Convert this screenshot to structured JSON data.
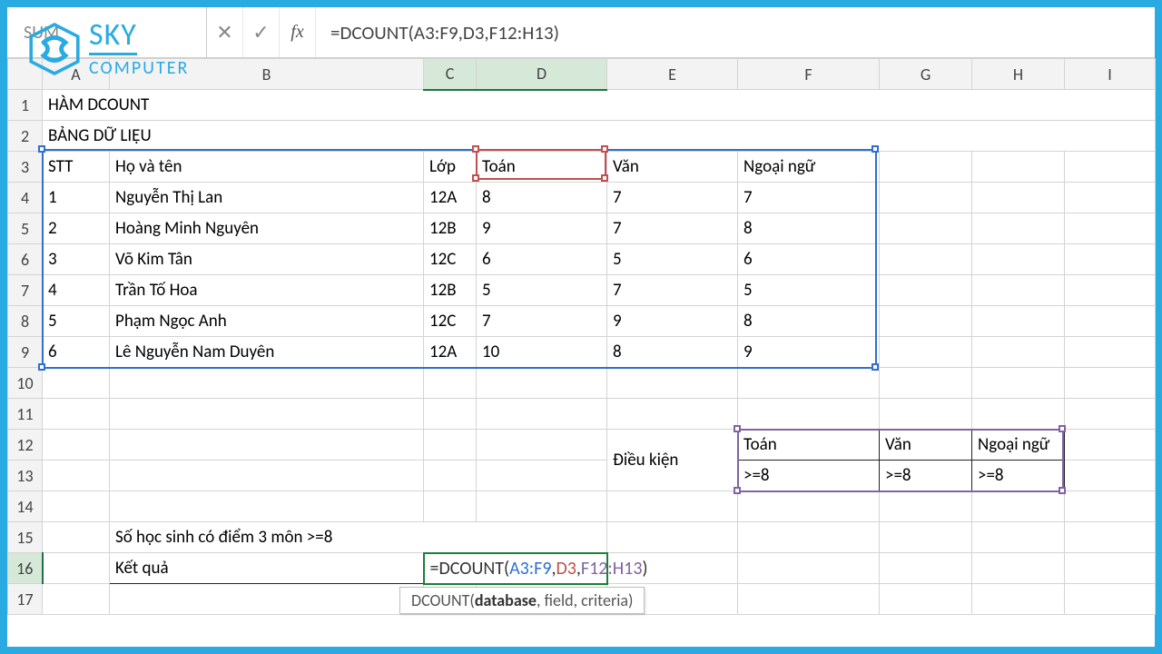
{
  "name_box": "SUM",
  "formula_bar": "=DCOUNT(A3:F9,D3,F12:H13)",
  "logo": {
    "brand": "SKY",
    "sub": "COMPUTER"
  },
  "columns": [
    "A",
    "B",
    "C",
    "D",
    "E",
    "F",
    "G",
    "H",
    "I"
  ],
  "rows": [
    "1",
    "2",
    "3",
    "4",
    "5",
    "6",
    "7",
    "8",
    "9",
    "10",
    "11",
    "12",
    "13",
    "14",
    "15",
    "16",
    "17"
  ],
  "title1": "HÀM DCOUNT",
  "title2": "BẢNG DỮ LIỆU",
  "db_headers": {
    "stt": "STT",
    "name": "Họ và tên",
    "class": "Lớp",
    "math": "Toán",
    "lit": "Văn",
    "lang": "Ngoại ngữ"
  },
  "db_rows": [
    {
      "stt": "1",
      "name": "Nguyễn Thị Lan",
      "class": "12A",
      "math": "8",
      "lit": "7",
      "lang": "7"
    },
    {
      "stt": "2",
      "name": "Hoàng Minh Nguyên",
      "class": "12B",
      "math": "9",
      "lit": "7",
      "lang": "8"
    },
    {
      "stt": "3",
      "name": "Võ Kim Tân",
      "class": "12C",
      "math": "6",
      "lit": "5",
      "lang": "6"
    },
    {
      "stt": "4",
      "name": "Trần Tố Hoa",
      "class": "12B",
      "math": "5",
      "lit": "7",
      "lang": "5"
    },
    {
      "stt": "5",
      "name": "Phạm Ngọc Anh",
      "class": "12C",
      "math": "7",
      "lit": "9",
      "lang": "8"
    },
    {
      "stt": "6",
      "name": "Lê Nguyễn Nam Duyên",
      "class": "12A",
      "math": "10",
      "lit": "8",
      "lang": "9"
    }
  ],
  "criteria": {
    "label": "Điều kiện",
    "headers": {
      "math": "Toán",
      "lit": "Văn",
      "lang": "Ngoại ngữ"
    },
    "values": {
      "math": ">=8",
      "lit": ">=8",
      "lang": ">=8"
    }
  },
  "result_section": {
    "title": "Số học sinh có điểm 3 môn  >=8",
    "label": "Kết quả",
    "formula_parts": {
      "pre": "=DCOUNT(",
      "db": "A3:F9",
      "c1": ",",
      "field": "D3",
      "c2": ",",
      "crit": "F12:H13",
      "post": ")"
    }
  },
  "tooltip": {
    "fn": "DCOUNT(",
    "p1": "database",
    "rest": ", field, criteria)"
  }
}
